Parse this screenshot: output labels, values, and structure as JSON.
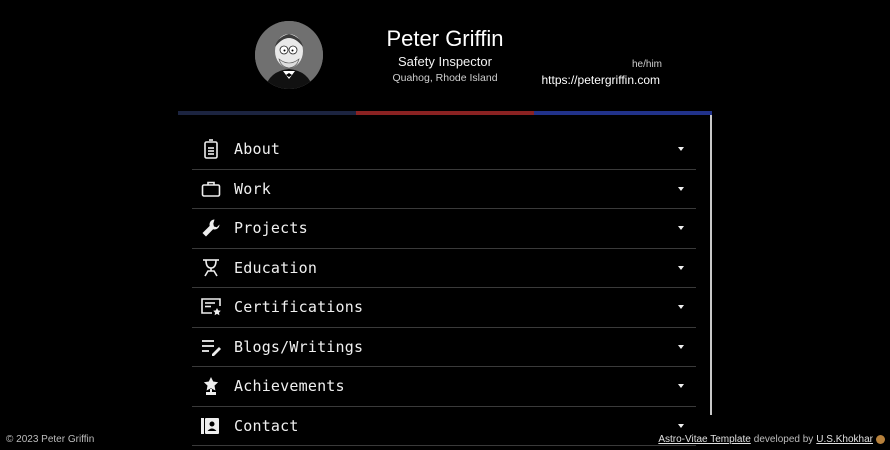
{
  "profile": {
    "name": "Peter Griffin",
    "title": "Safety Inspector",
    "location": "Quahog, Rhode Island",
    "pronouns": "he/him",
    "website": "https://petergriffin.com"
  },
  "colors": {
    "background": "#000000",
    "bar_left": "#1c2440",
    "bar_middle": "#8a2222",
    "bar_right": "#21328a"
  },
  "menu": {
    "items": [
      {
        "label": "About",
        "icon": "id-badge-icon"
      },
      {
        "label": "Work",
        "icon": "briefcase-icon"
      },
      {
        "label": "Projects",
        "icon": "wrench-icon"
      },
      {
        "label": "Education",
        "icon": "graduation-icon"
      },
      {
        "label": "Certifications",
        "icon": "certificate-icon"
      },
      {
        "label": "Blogs/Writings",
        "icon": "edit-list-icon"
      },
      {
        "label": "Achievements",
        "icon": "trophy-icon"
      },
      {
        "label": "Contact",
        "icon": "contact-book-icon"
      }
    ]
  },
  "footer": {
    "copyright": "© 2023 Peter Griffin",
    "template_link": "Astro-Vitae Template",
    "developed_by": "developed by",
    "author_link": "U.S.Khokhar"
  }
}
